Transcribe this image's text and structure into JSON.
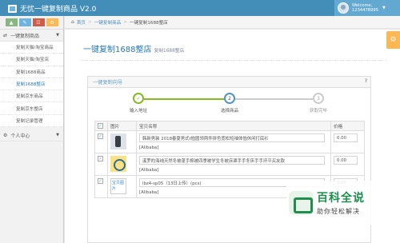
{
  "app": {
    "brand": "无忧一键复制商品 V2.0"
  },
  "user": {
    "welcome": "Welcome,",
    "name": "1234478995"
  },
  "shortcuts": [
    {
      "label": "▲",
      "color": "#87b87f"
    },
    {
      "label": "✎",
      "color": "#6fb3e0"
    },
    {
      "label": "☷",
      "color": "#d15b47"
    },
    {
      "label": "⚙",
      "color": "#ffb752"
    }
  ],
  "sidebar": {
    "group": "一键复制商品",
    "items": [
      {
        "label": "复制天猫/淘宝商品"
      },
      {
        "label": "复制天猫/淘宝店"
      },
      {
        "label": "复制1688商品"
      },
      {
        "label": "复制1688整店"
      },
      {
        "label": "复制京东商品"
      },
      {
        "label": "复制京东整店"
      },
      {
        "label": "复制记录管理"
      }
    ],
    "personal": "个人中心"
  },
  "breadcrumb": {
    "home": "首页",
    "section": "一键复制商品",
    "current": "一键复制1688整店"
  },
  "page": {
    "title": "一键复制1688整店",
    "subtitle": "复制1688整店"
  },
  "wizard": {
    "title": "一键复制向导",
    "help": "?",
    "steps": [
      {
        "label": "输入地址",
        "num": "✓"
      },
      {
        "label": "选择商品",
        "num": "2"
      },
      {
        "label": "获取完毕",
        "num": "3"
      }
    ]
  },
  "table": {
    "headers": {
      "image": "图片",
      "name": "宝贝名称",
      "price": "价格"
    },
    "rows": [
      {
        "name": "韩新男装 2018春夏男式t恤圆领两件拼色宽松短袖体恤休闲打底衫",
        "source": "[Alibaba]",
        "price": "0.00"
      },
      {
        "name": "溪罗的海纯天然冬被蓬手棉被四季被学生冬被床罩手手冬床手手环平买友款",
        "source": "[Alibaba]",
        "price": "0.00"
      },
      {
        "image_alt": "宝贝图片",
        "name": "lbz4-sp05（13日上传）(pcs)",
        "source": "[Alibaba]",
        "price": "0.00"
      }
    ]
  },
  "watermark": {
    "big": "百科全说",
    "small": "助你轻松解决"
  },
  "colors": {
    "navbar": "#438eb9",
    "accent": "#2679b5",
    "step_done": "#87ba21",
    "step_active": "#5293c4"
  }
}
